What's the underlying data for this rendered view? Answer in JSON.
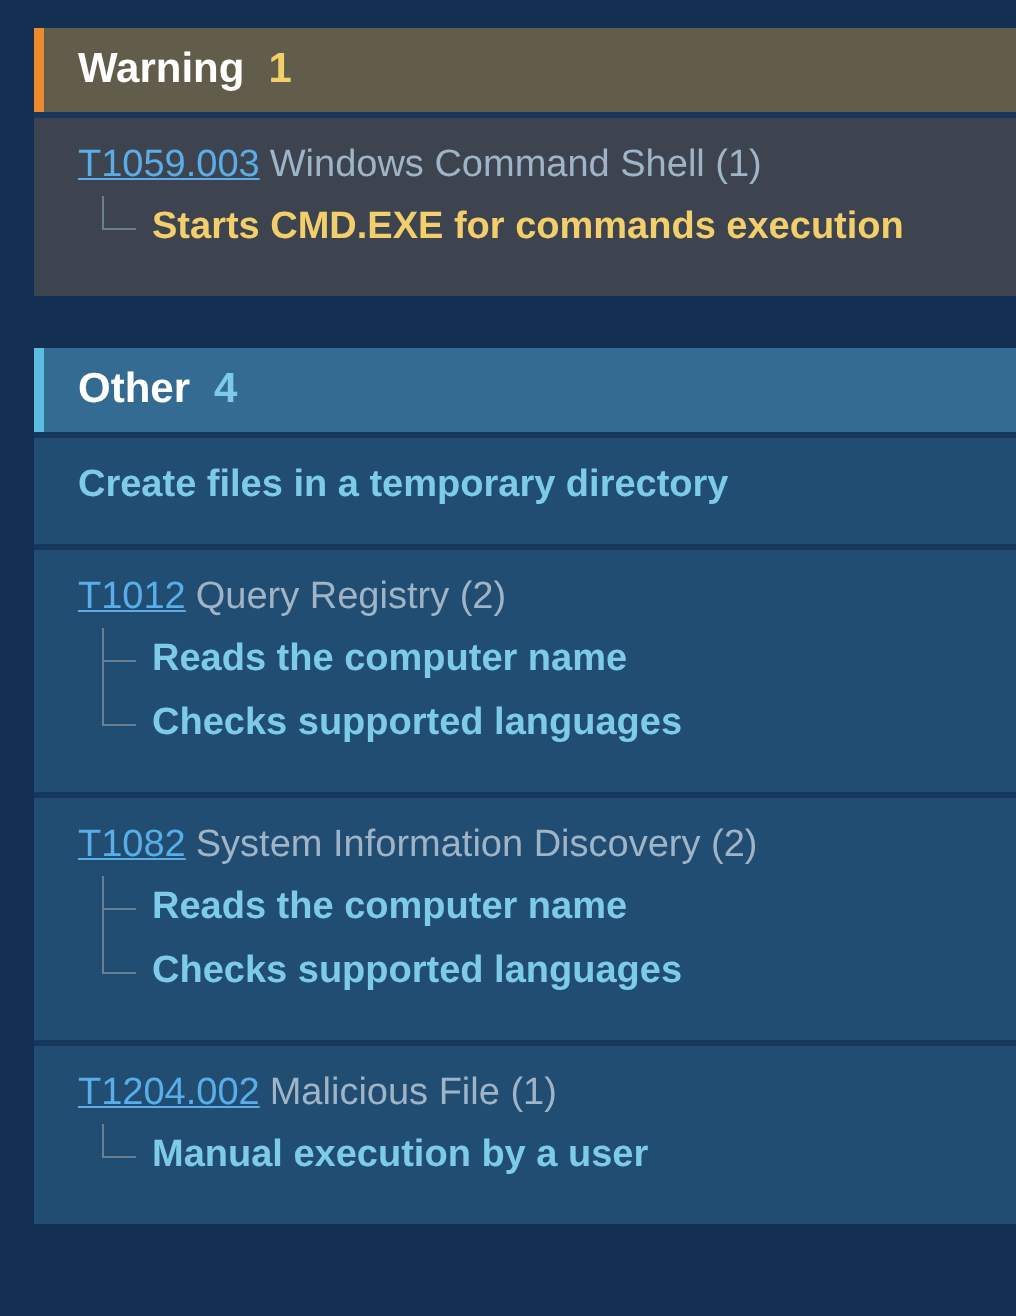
{
  "sections": [
    {
      "kind": "warning",
      "title": "Warning",
      "count": "1",
      "items": [
        {
          "kind": "technique",
          "id": "T1059.003",
          "name": "Windows Command Shell (1)",
          "behaviors": [
            "Starts CMD.EXE for commands execution"
          ]
        }
      ]
    },
    {
      "kind": "other",
      "title": "Other",
      "count": "4",
      "items": [
        {
          "kind": "behavior",
          "text": "Create files in a temporary directory"
        },
        {
          "kind": "technique",
          "id": "T1012",
          "name": "Query Registry (2)",
          "behaviors": [
            "Reads the computer name",
            "Checks supported languages"
          ]
        },
        {
          "kind": "technique",
          "id": "T1082",
          "name": "System Information Discovery (2)",
          "behaviors": [
            "Reads the computer name",
            "Checks supported languages"
          ]
        },
        {
          "kind": "technique",
          "id": "T1204.002",
          "name": "Malicious File (1)",
          "behaviors": [
            "Manual execution by a user"
          ]
        }
      ]
    }
  ]
}
